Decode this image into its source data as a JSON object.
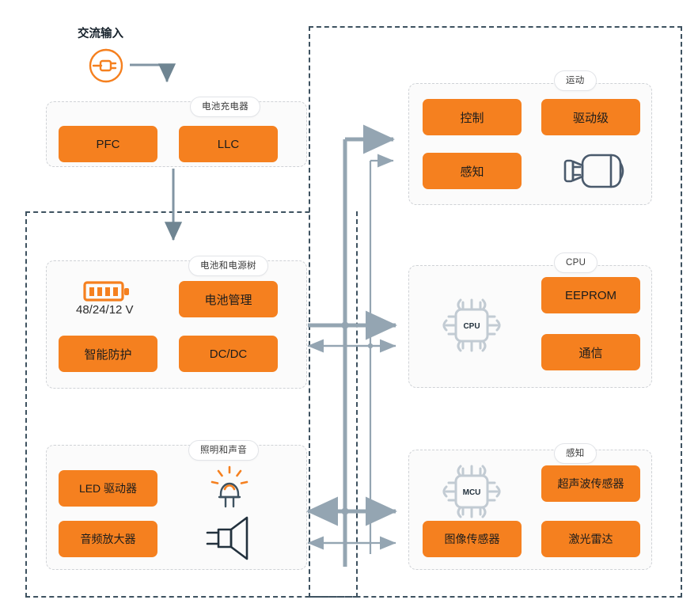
{
  "diagram": {
    "title_label": "交流输入",
    "battery_voltage_label": "48/24/12 V",
    "colors": {
      "accent_orange": "#f5801f",
      "outline_dark": "#3e5260",
      "bus_gray": "#94a5b2",
      "panel_border": "#cfd2d6",
      "panel_fill": "#fbfbfb"
    },
    "icons": {
      "ac_plug": "ac-plug-icon",
      "battery": "battery-icon",
      "led": "led-lamp-icon",
      "speaker": "speaker-icon",
      "motor": "motor-icon",
      "cpu_chip": "cpu-chip-icon",
      "mcu_chip": "mcu-chip-icon"
    },
    "chip_labels": {
      "cpu": "CPU",
      "mcu": "MCU"
    },
    "groups": [
      {
        "id": "battery-charger",
        "title": "电池充电器",
        "blocks": [
          {
            "id": "pfc",
            "label": "PFC"
          },
          {
            "id": "llc",
            "label": "LLC"
          }
        ]
      },
      {
        "id": "battery-power-tree",
        "title": "电池和电源树",
        "blocks": [
          {
            "id": "battery-management",
            "label": "电池管理"
          },
          {
            "id": "smart-protection",
            "label": "智能防护"
          },
          {
            "id": "dcdc",
            "label": "DC/DC"
          }
        ]
      },
      {
        "id": "lighting-sound",
        "title": "照明和声音",
        "blocks": [
          {
            "id": "led-driver",
            "label": "LED 驱动器"
          },
          {
            "id": "audio-amplifier",
            "label": "音频放大器"
          }
        ]
      },
      {
        "id": "motion",
        "title": "运动",
        "blocks": [
          {
            "id": "control",
            "label": "控制"
          },
          {
            "id": "drive-stage",
            "label": "驱动级"
          },
          {
            "id": "sense",
            "label": "感知"
          }
        ]
      },
      {
        "id": "cpu",
        "title": "CPU",
        "blocks": [
          {
            "id": "eeprom",
            "label": "EEPROM"
          },
          {
            "id": "communication",
            "label": "通信"
          }
        ]
      },
      {
        "id": "sensing",
        "title": "感知",
        "blocks": [
          {
            "id": "ultrasonic-sensor",
            "label": "超声波传感器"
          },
          {
            "id": "image-sensor",
            "label": "图像传感器"
          },
          {
            "id": "lidar",
            "label": "激光雷达"
          }
        ]
      }
    ]
  }
}
